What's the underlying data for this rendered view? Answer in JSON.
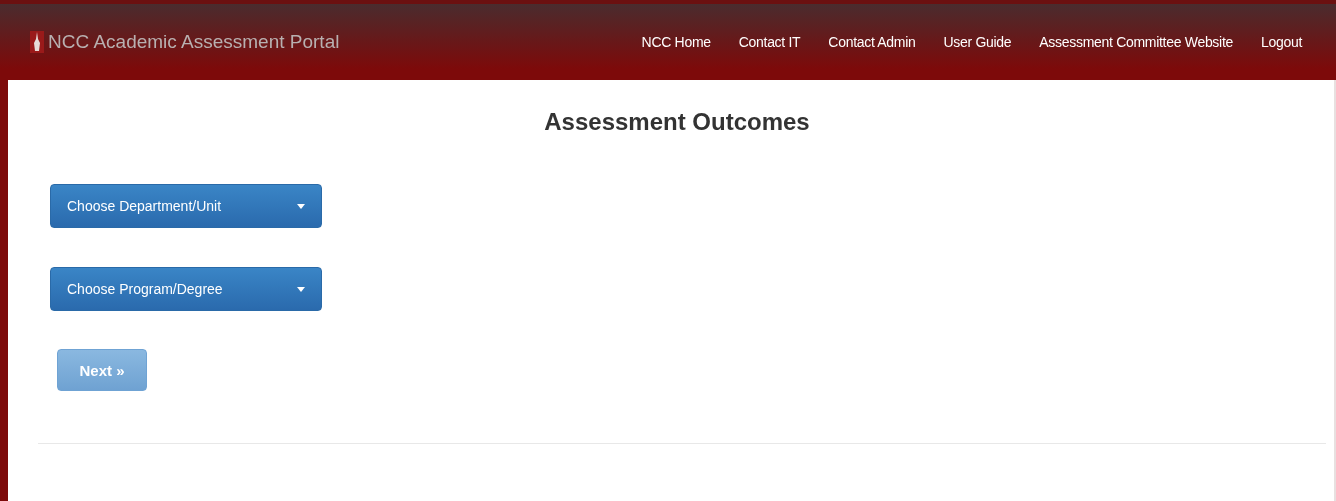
{
  "navbar": {
    "brand": "NCC Academic Assessment Portal",
    "links": [
      "NCC Home",
      "Contact IT",
      "Contact Admin",
      "User Guide",
      "Assessment Committee Website",
      "Logout"
    ]
  },
  "page": {
    "title": "Assessment Outcomes"
  },
  "dropdowns": [
    {
      "label": "Choose Department/Unit"
    },
    {
      "label": "Choose Program/Degree"
    }
  ],
  "next_button": {
    "label": "Next »",
    "disabled": true
  }
}
